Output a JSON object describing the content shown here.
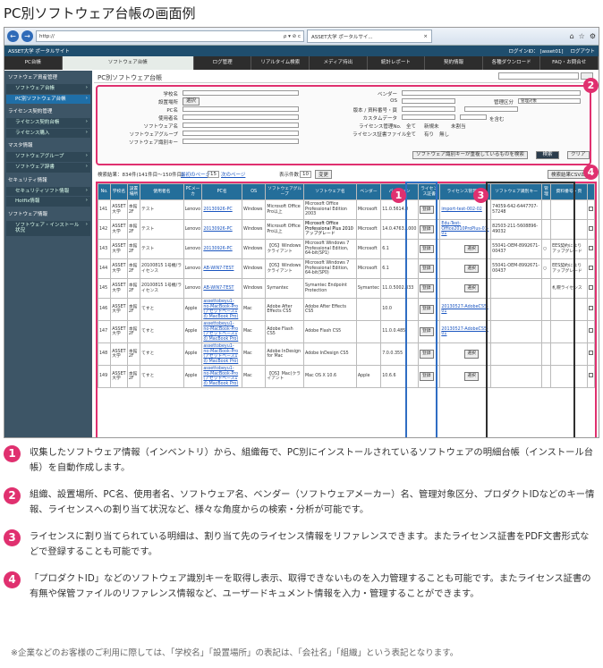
{
  "page_title": "PC別ソフトウェア台帳の画面例",
  "browser": {
    "address_text": "http://",
    "address_suffix": "ρ ▾ ⊘ c",
    "tab_title": "ASSET大学 ポータルサイ...",
    "tab_close": "×"
  },
  "app_header": {
    "site_name": "ASSET大学 ポータルサイト",
    "login_id": "ログインID： [asset01]",
    "logout": "ログアウト"
  },
  "menu": [
    "PC台帳",
    "ソフトウェア台帳",
    "ログ管理",
    "リアルタイム検索",
    "メディア持出",
    "統計レポート",
    "契約情報",
    "各種ダウンロード",
    "FAQ・お問合せ"
  ],
  "sidebar": [
    {
      "header": "ソフトウェア資産管理",
      "items": [
        "ソフトウェア台帳",
        "PC別ソフトウェア台帳"
      ]
    },
    {
      "header": "ライセンス契約管理",
      "items": [
        "ライセンス契約台帳",
        "ライセンス購入"
      ]
    },
    {
      "header": "マスタ情報",
      "items": [
        "ソフトウェアグループ",
        "ソフトウェア辞書"
      ]
    },
    {
      "header": "セキュリティ情報",
      "items": [
        "セキュリティソフト情報",
        "Hotfix情報"
      ]
    },
    {
      "header": "ソフトウェア情報",
      "items": [
        "ソフトウェア・インストール状況"
      ]
    }
  ],
  "screen_title": "PC別ソフトウェア台帳",
  "search_labels": {
    "school": "学校名",
    "location": "設置場所",
    "select": "選択",
    "pcname": "PC名",
    "user": "使用者名",
    "software": "ソフトウェア名",
    "group": "ソフトウェアグループ",
    "license_key": "ソフトウェア識別キー",
    "vendor": "ベンダー",
    "os": "OS",
    "mgmt": "管理区分",
    "mgmt_value": "管理対象",
    "serial": "版本 / 資料番号・頁",
    "custom": "カスタムデータ",
    "include": "を含む",
    "license_mgmt": "ライセンス管理No.",
    "all": "全て",
    "unreg": "新規未",
    "unassigned": "未割当",
    "license_file": "ライセンス証書ファイル",
    "all2": "全て",
    "yes": "有り",
    "no": "無し",
    "register_btn": "ソフトウェア識別キーが重複しているものを検索",
    "search_btn": "検索",
    "clear_btn": "クリア"
  },
  "results": {
    "count": "検索結果：834件(141件目〜150件目)",
    "first": "最初のページ",
    "page": "15",
    "next": "次のページ",
    "per_page_label": "表示件数",
    "per_page": "10",
    "change": "変更",
    "export": "検索結果CSV出力"
  },
  "table_headers": [
    "No.",
    "学校名",
    "設置場所",
    "使用者名",
    "PCメーカ",
    "PC名",
    "OS",
    "ソフトウェアグループ",
    "ソフトウェア名",
    "ベンダー",
    "バージョン",
    "ライセンス証書",
    "ライセンス管理No.",
    "ソフトウェア識別キー",
    "管理",
    "資料番号・頁"
  ],
  "col3_header": {
    "title": "ソフトウェア識別キー",
    "btn": "編集",
    "sub": "資料番号・頁",
    "sub_btn": "編集"
  },
  "rows": [
    {
      "no": "141",
      "school": "ASSET大学",
      "loc": "本館2F",
      "user": "テスト",
      "maker": "Lenovo",
      "pc": "20130926-PC",
      "os": "Windows",
      "group": "Microsoft Office Pro以上",
      "sw": "Microsoft Office Professional Edition 2003",
      "vendor": "Microsoft",
      "ver": "11.0.5614.0",
      "lic": "登録",
      "mgmt": "import-test-002-02",
      "key": "74059-642-6447707-57248",
      "kanri": "",
      "doc": ""
    },
    {
      "no": "142",
      "school": "ASSET大学",
      "loc": "本館2F",
      "user": "テスト",
      "maker": "Lenovo",
      "pc": "20130926-PC",
      "os": "Windows",
      "group": "Microsoft Office Pro以上",
      "sw": "Microsoft Office Professional Plus 2010 アップグレード",
      "vendor": "Microsoft",
      "ver": "14.0.4763.1000",
      "lic": "登録",
      "mgmt": "Edu-Test-Office2010ProPlus-01-01",
      "key": "82503-211-5608896-49032",
      "kanri": "",
      "doc": ""
    },
    {
      "no": "143",
      "school": "ASSET大学",
      "loc": "本館2F",
      "user": "テスト",
      "maker": "Lenovo",
      "pc": "20130926-PC",
      "os": "Windows",
      "group": "【OS】Windows クライアント",
      "sw": "Microsoft Windows 7 Professional Edition, 64-bit(SP1)",
      "vendor": "Microsoft",
      "ver": "6.1",
      "lic": "登録",
      "mgmt": "選択",
      "key": "55041-OEM-8992671-00437",
      "kanri": "○",
      "doc": "EES契約によりアップグレード"
    },
    {
      "no": "144",
      "school": "ASSET大学",
      "loc": "本館2F",
      "user": "20100815 1号機/ライセンス",
      "maker": "Lenovo",
      "pc": "AB-WIN7-TEST",
      "os": "Windows",
      "group": "【OS】Windows クライアント",
      "sw": "Microsoft Windows 7 Professional Edition, 64-bit(SP0)",
      "vendor": "Microsoft",
      "ver": "6.1",
      "lic": "登録",
      "mgmt": "選択",
      "key": "55041-OEM-8992671-00437",
      "kanri": "○",
      "doc": "EES契約によりアップグレード"
    },
    {
      "no": "145",
      "school": "ASSET大学",
      "loc": "本館2F",
      "user": "20100815 1号機/ライセンス",
      "maker": "Lenovo",
      "pc": "AB-WIN7-TEST",
      "os": "Windows",
      "group": "Symantec",
      "sw": "Symantec Endpoint Protection",
      "vendor": "Symantec",
      "ver": "11.0.5002.333",
      "lic": "登録",
      "mgmt": "選択",
      "key": "",
      "kanri": "",
      "doc": "札幌ライセンス"
    },
    {
      "no": "146",
      "school": "ASSET大学",
      "loc": "本館2F",
      "user": "てすと",
      "maker": "Apple",
      "pc": "assettobeyu1-no-MacBook-Pro (アセットベース1 の MacBook Pro)",
      "os": "Mac",
      "group": "Adobe After Effects CS5",
      "sw": "Adobe After Effects CS5",
      "vendor": "",
      "ver": "10.0",
      "lic": "登録",
      "mgmt": "20130527-AdobeCS5-01",
      "key": "",
      "kanri": "",
      "doc": ""
    },
    {
      "no": "147",
      "school": "ASSET大学",
      "loc": "本館2F",
      "user": "てすと",
      "maker": "Apple",
      "pc": "assettobeyu1-no-MacBook-Pro (アセットベース1 の MacBook Pro)",
      "os": "Mac",
      "group": "Adobe Flash CS5",
      "sw": "Adobe Flash CS5",
      "vendor": "",
      "ver": "11.0.0.485",
      "lic": "登録",
      "mgmt": "20130527-AdobeCS5-01",
      "key": "",
      "kanri": "",
      "doc": ""
    },
    {
      "no": "148",
      "school": "ASSET大学",
      "loc": "本館2F",
      "user": "てすと",
      "maker": "Apple",
      "pc": "assettobeyu1-no-MacBook-Pro (アセットベース1 の MacBook Pro)",
      "os": "Mac",
      "group": "Adobe InDesign for Mac",
      "sw": "Adobe InDesign CS5",
      "vendor": "",
      "ver": "7.0.0.355",
      "lic": "登録",
      "mgmt": "選択",
      "key": "",
      "kanri": "",
      "doc": ""
    },
    {
      "no": "149",
      "school": "ASSET大学",
      "loc": "本館2F",
      "user": "てすと",
      "maker": "Apple",
      "pc": "assettobeyu1-no-MacBook-Pro (アセットベース1 の MacBook Pro)",
      "os": "Mac",
      "group": "【OS】Mac(クライアント",
      "sw": "Mac OS X 10.6",
      "vendor": "Apple",
      "ver": "10.6.6",
      "lic": "登録",
      "mgmt": "選択",
      "key": "",
      "kanri": "",
      "doc": ""
    }
  ],
  "badges": [
    "1",
    "2",
    "3",
    "4"
  ],
  "descriptions": [
    {
      "num": "1",
      "text": "収集したソフトウェア情報（インベントリ）から、組織毎で、PC別にインストールされているソフトウェアの明細台帳（インストール台帳）を自動作成します。"
    },
    {
      "num": "2",
      "text": "組織、設置場所、PC名、使用者名、ソフトウェア名、ベンダー（ソフトウェアメーカー）名、管理対象区分、プロダクトIDなどのキー情報、ライセンスへの割り当て状況など、様々な角度からの検索・分析が可能です。"
    },
    {
      "num": "3",
      "text": "ライセンスに割り当てられている明細は、割り当て先のライセンス情報をリファレンスできます。またライセンス証書をPDF文書形式などで登録することも可能です。"
    },
    {
      "num": "4",
      "text": "「プロダクトID」などのソフトウェア識別キーを取得し表示、取得できないものを入力管理することも可能です。またライセンス証書の有無や保管ファイルのリファレンス情報など、ユーザードキュメント情報を入力・管理することができます。"
    }
  ],
  "footnote": "※企業などのお客様のご利用に際しては、「学校名」「設置場所」の表記は、「会社名」「組織」という表記となります。"
}
